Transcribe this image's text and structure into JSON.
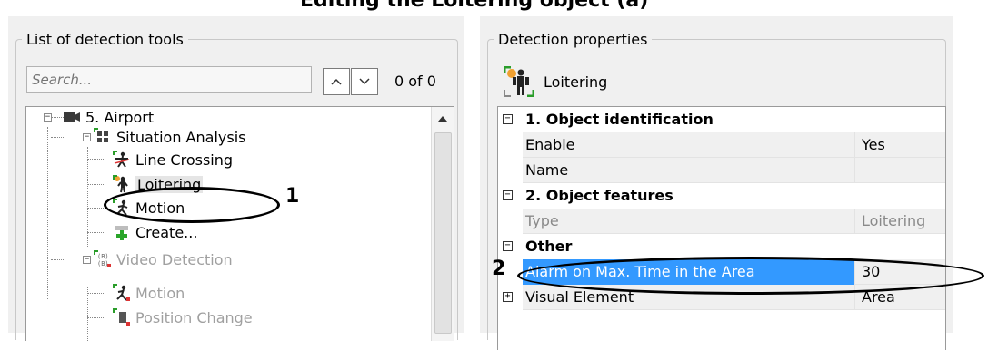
{
  "caption": "Editing the Loitering object (a)",
  "left_panel": {
    "title": "List of detection tools",
    "search": {
      "placeholder": "Search...",
      "value": ""
    },
    "counter": "0 of 0",
    "tree": [
      {
        "label": "5. Airport",
        "icon": "camera-icon",
        "level": 0,
        "expander": "minus"
      },
      {
        "label": "Situation Analysis",
        "icon": "situation-analysis-icon",
        "level": 1,
        "expander": "minus"
      },
      {
        "label": "Line Crossing",
        "icon": "line-crossing-icon",
        "level": 2
      },
      {
        "label": "Loitering",
        "icon": "loitering-icon",
        "level": 2,
        "selected": true
      },
      {
        "label": "Motion",
        "icon": "motion-icon",
        "level": 2
      },
      {
        "label": "Create...",
        "icon": "create-plus-icon",
        "level": 2
      },
      {
        "label": "Video Detection",
        "icon": "video-detection-icon",
        "level": 1,
        "expander": "minus",
        "disabled": true
      },
      {
        "label": "Motion",
        "icon": "motion-icon",
        "level": 2,
        "disabled": true
      },
      {
        "label": "Position Change",
        "icon": "position-change-icon",
        "level": 2,
        "disabled": true
      }
    ],
    "callout_number": "1"
  },
  "right_panel": {
    "title": "Detection properties",
    "tool_name": "Loitering",
    "rows": [
      {
        "kind": "category",
        "name": "1. Object identification",
        "expander": "minus"
      },
      {
        "kind": "item",
        "name": "Enable",
        "value": "Yes"
      },
      {
        "kind": "item",
        "name": "Name",
        "value": ""
      },
      {
        "kind": "category",
        "name": "2. Object features",
        "expander": "minus"
      },
      {
        "kind": "item",
        "name": "Type",
        "value": "Loitering",
        "readonly": true
      },
      {
        "kind": "category",
        "name": "Other",
        "expander": "minus"
      },
      {
        "kind": "item",
        "name": "Alarm on Max. Time in the Area",
        "value": "30",
        "selected": true
      },
      {
        "kind": "item",
        "name": "Visual Element",
        "value": "Area",
        "expander": "plus"
      }
    ],
    "callout_number": "2"
  },
  "colors": {
    "selection": "#3399ff",
    "panel_bg": "#f0f0f0",
    "disabled_text": "#a0a0a0"
  }
}
